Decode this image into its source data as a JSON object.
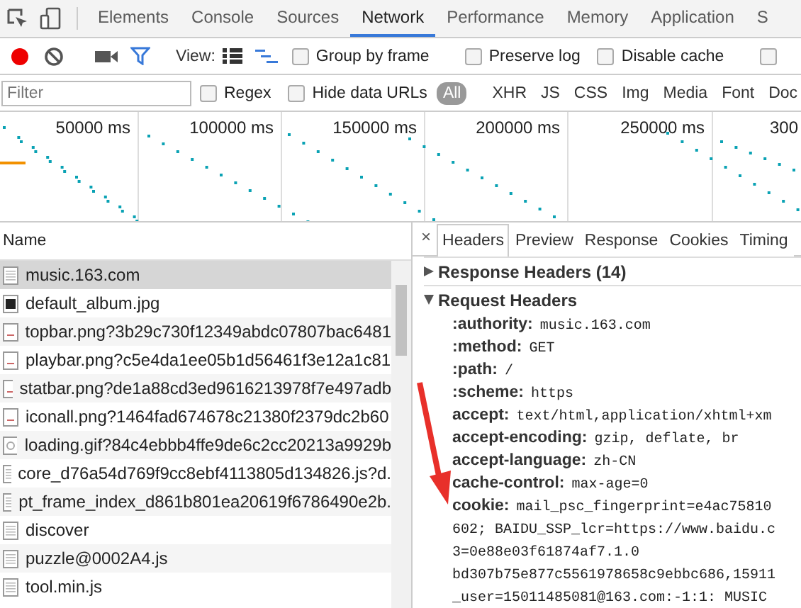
{
  "main_tabs": [
    {
      "label": "Elements",
      "selected": false
    },
    {
      "label": "Console",
      "selected": false
    },
    {
      "label": "Sources",
      "selected": false
    },
    {
      "label": "Network",
      "selected": true
    },
    {
      "label": "Performance",
      "selected": false
    },
    {
      "label": "Memory",
      "selected": false
    },
    {
      "label": "Application",
      "selected": false
    },
    {
      "label": "S",
      "selected": false
    }
  ],
  "toolbar": {
    "recording": true,
    "filter_active": true,
    "view_label": "View:",
    "large_rows": false,
    "overview": true,
    "checkboxes": [
      {
        "label": "Group by frame",
        "checked": false
      },
      {
        "label": "Preserve log",
        "checked": false
      },
      {
        "label": "Disable cache",
        "checked": false
      },
      {
        "checked": false
      }
    ]
  },
  "filter_bar": {
    "placeholder": "Filter",
    "checkboxes": [
      {
        "label": "Regex",
        "checked": false
      },
      {
        "label": "Hide data URLs",
        "checked": false
      }
    ],
    "types": [
      {
        "label": "All",
        "selected": true
      },
      {
        "label": "XHR",
        "selected": false
      },
      {
        "label": "JS",
        "selected": false
      },
      {
        "label": "CSS",
        "selected": false
      },
      {
        "label": "Img",
        "selected": false
      },
      {
        "label": "Media",
        "selected": false
      },
      {
        "label": "Font",
        "selected": false
      },
      {
        "label": "Doc",
        "selected": false
      }
    ]
  },
  "overview": {
    "ticks": [
      "50000 ms",
      "100000 ms",
      "150000 ms",
      "200000 ms",
      "250000 ms",
      "300"
    ]
  },
  "requests": {
    "column": "Name",
    "rows": [
      {
        "name": "music.163.com",
        "kind": "doc",
        "selected": true
      },
      {
        "name": "default_album.jpg",
        "kind": "photo",
        "selected": false
      },
      {
        "name": "topbar.png?3b29c730f12349abdc07807bac6481",
        "kind": "image",
        "selected": false
      },
      {
        "name": "playbar.png?c5e4da1ee05b1d56461f3e12a1c81",
        "kind": "image",
        "selected": false
      },
      {
        "name": "statbar.png?de1a88cd3ed9616213978f7e497adb",
        "kind": "image",
        "selected": false
      },
      {
        "name": "iconall.png?1464fad674678c21380f2379dc2b60",
        "kind": "image",
        "selected": false
      },
      {
        "name": "loading.gif?84c4ebbb4ffe9de6c2cc20213a9929b",
        "kind": "gif",
        "selected": false
      },
      {
        "name": "core_d76a54d769f9cc8ebf4113805d134826.js?d.",
        "kind": "doc",
        "selected": false
      },
      {
        "name": "pt_frame_index_d861b801ea20619f6786490e2b.",
        "kind": "doc",
        "selected": false
      },
      {
        "name": "discover",
        "kind": "doc",
        "selected": false
      },
      {
        "name": "puzzle@0002A4.js",
        "kind": "doc",
        "selected": false
      },
      {
        "name": "tool.min.js",
        "kind": "doc",
        "selected": false
      }
    ]
  },
  "details": {
    "close": "×",
    "tabs": [
      {
        "label": "Headers",
        "selected": true
      },
      {
        "label": "Preview",
        "selected": false
      },
      {
        "label": "Response",
        "selected": false
      },
      {
        "label": "Cookies",
        "selected": false
      },
      {
        "label": "Timing",
        "selected": false
      }
    ],
    "sections": [
      {
        "title": "Response Headers (14)",
        "expanded": false
      },
      {
        "title": "Request Headers",
        "expanded": true,
        "headers": [
          {
            "key": ":authority:",
            "value": "music.163.com"
          },
          {
            "key": ":method:",
            "value": "GET"
          },
          {
            "key": ":path:",
            "value": "/"
          },
          {
            "key": ":scheme:",
            "value": "https"
          },
          {
            "key": "accept:",
            "value": "text/html,application/xhtml+xm"
          },
          {
            "key": "accept-encoding:",
            "value": "gzip, deflate, br"
          },
          {
            "key": "accept-language:",
            "value": "zh-CN"
          },
          {
            "key": "cache-control:",
            "value": "max-age=0"
          },
          {
            "key": "cookie:",
            "value": "mail_psc_fingerprint=e4ac75810"
          },
          {
            "value": "602; BAIDU_SSP_lcr=https://www.baidu.c"
          },
          {
            "value": "3=0e88e03f61874af7.1.0"
          },
          {
            "value": "bd307b75e877c5561978658c9ebbc686,15911"
          },
          {
            "value": "_user=15011485081@163.com:-1:1: MUSIC"
          }
        ]
      }
    ]
  }
}
